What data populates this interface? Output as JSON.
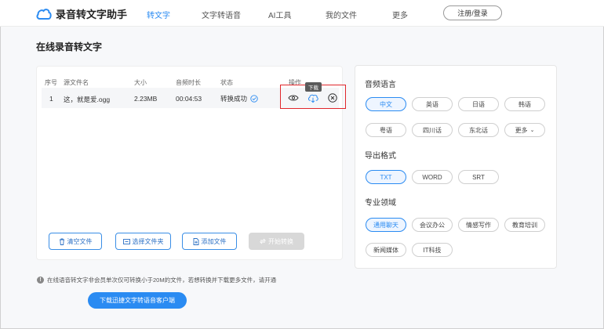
{
  "header": {
    "app_name": "录音转文字助手",
    "nav": [
      "转文字",
      "文字转语音",
      "AI工具",
      "我的文件",
      "更多"
    ],
    "login_label": "注册/登录"
  },
  "page_title": "在线录音转文字",
  "file_table": {
    "headers": [
      "序号",
      "源文件名",
      "大小",
      "音频时长",
      "状态",
      "操作"
    ],
    "rows": [
      {
        "index": "1",
        "name": "这，就是爱.ogg",
        "size": "2.23MB",
        "duration": "00:04:53",
        "status": "转换成功"
      }
    ],
    "tooltip": "下载"
  },
  "buttons": {
    "clear": "清空文件",
    "select_folder": "选择文件夹",
    "add_file": "添加文件",
    "start": "开始转换"
  },
  "notice": "在线语音转文字非会员单次仅可转换小于20M的文件，若想转换并下载更多文件，请开通",
  "download_client": "下载迅捷文字转语音客户端",
  "settings": {
    "language_title": "音频语言",
    "languages": [
      "中文",
      "英语",
      "日语",
      "韩语",
      "粤语",
      "四川话",
      "东北话",
      "更多"
    ],
    "selected_language": "中文",
    "format_title": "导出格式",
    "formats": [
      "TXT",
      "WORD",
      "SRT"
    ],
    "selected_format": "TXT",
    "domain_title": "专业领域",
    "domains": [
      "通用聊天",
      "会议办公",
      "情感写作",
      "教育培训",
      "新闻媒体",
      "IT科技"
    ],
    "selected_domain": "通用聊天"
  },
  "colors": {
    "accent": "#2a8bf2",
    "highlight_box": "#e0262b"
  }
}
